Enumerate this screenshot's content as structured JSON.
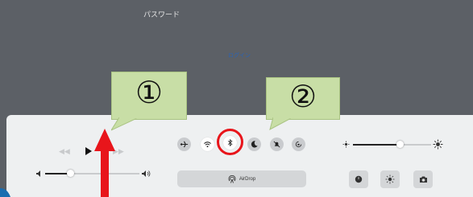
{
  "login_screen": {
    "password_label": "パスワード",
    "login_link": "ログイン"
  },
  "callouts": [
    {
      "label": "①"
    },
    {
      "label": "②"
    }
  ],
  "control_center": {
    "media": {
      "rewind_icon": "◀◀",
      "forward_icon": "▶▶",
      "volume_level": 0.27
    },
    "toggles": [
      {
        "name": "airplane-mode",
        "state": "off"
      },
      {
        "name": "wifi",
        "state": "on"
      },
      {
        "name": "bluetooth",
        "state": "on"
      },
      {
        "name": "do-not-disturb",
        "state": "off"
      },
      {
        "name": "silent",
        "state": "off"
      },
      {
        "name": "rotation-lock",
        "state": "off"
      }
    ],
    "brightness_level": 0.6,
    "airdrop_label": "AirDrop"
  },
  "colors": {
    "callout_fill": "#c8dea6",
    "highlight_ring": "#e8151b",
    "arrow": "#e8151b",
    "lock_bg": "#5c6066",
    "panel_bg": "#eef0f1"
  }
}
